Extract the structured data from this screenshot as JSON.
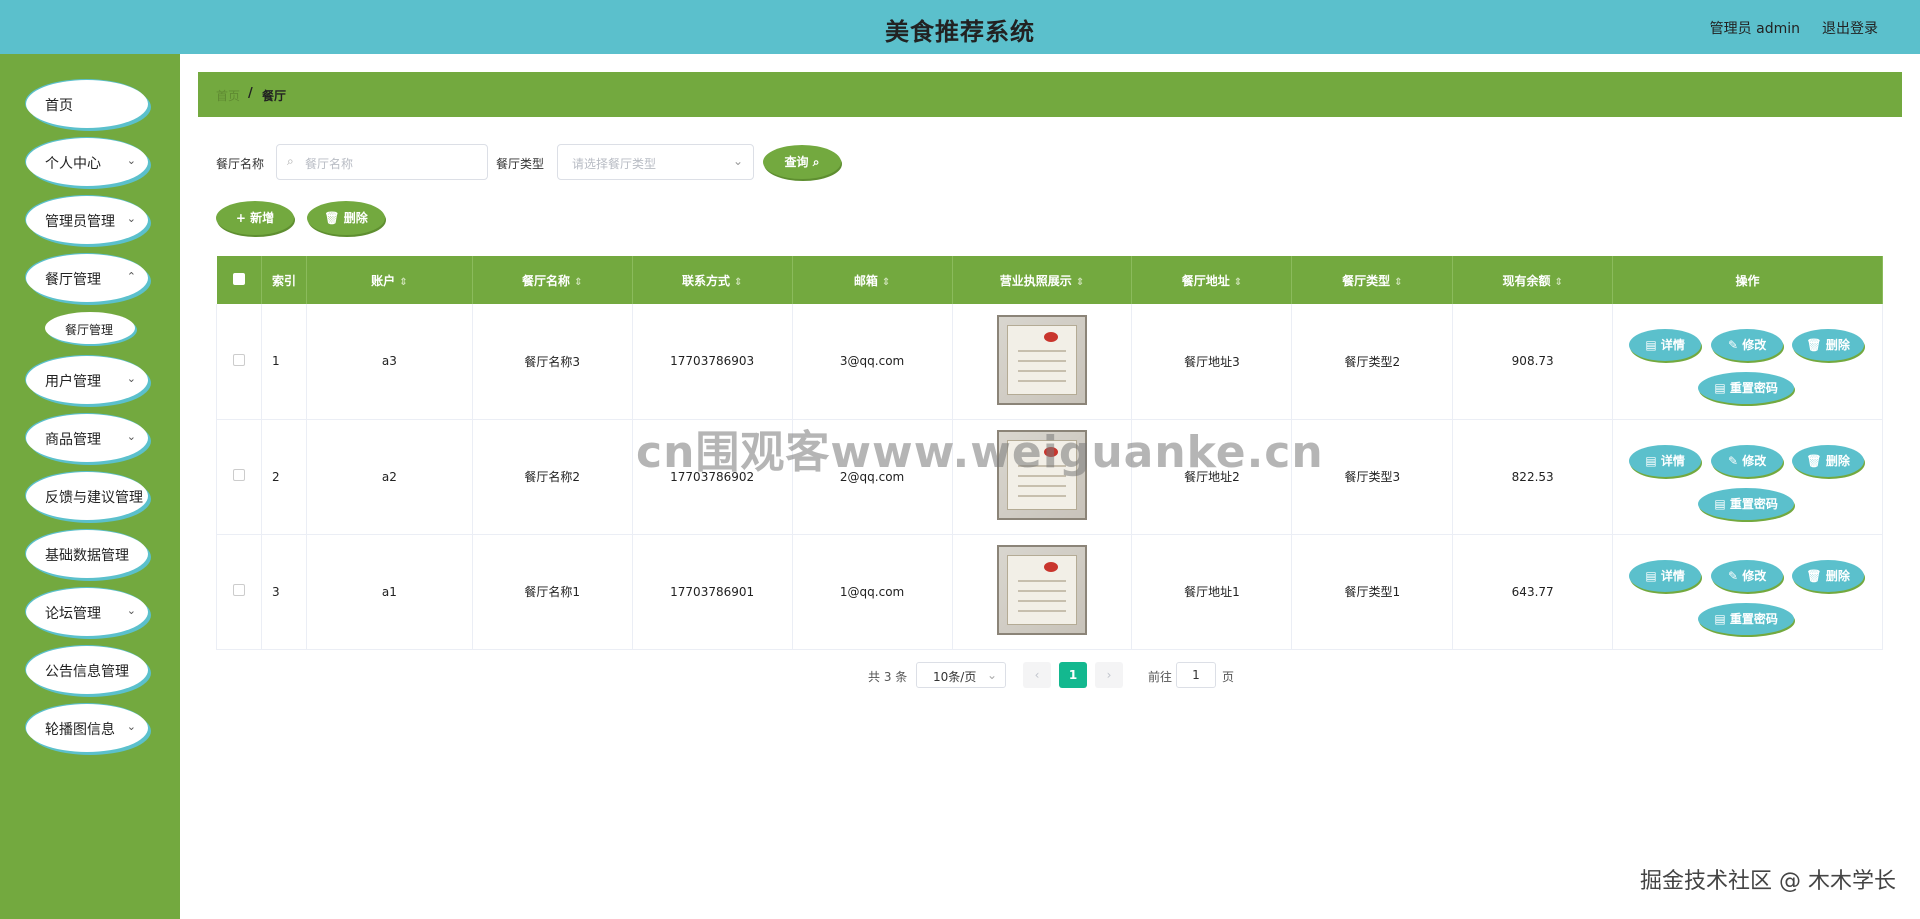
{
  "header": {
    "title": "美食推荐系统",
    "admin": "管理员 admin",
    "logout": "退出登录"
  },
  "sidebar": {
    "items": [
      {
        "label": "首页",
        "chevron": false
      },
      {
        "label": "个人中心",
        "chevron": true
      },
      {
        "label": "管理员管理",
        "chevron": true
      },
      {
        "label": "餐厅管理",
        "chevron": true
      },
      {
        "label": "用户管理",
        "chevron": true
      },
      {
        "label": "商品管理",
        "chevron": true
      },
      {
        "label": "反馈与建议管理",
        "chevron": true
      },
      {
        "label": "基础数据管理",
        "chevron": true
      },
      {
        "label": "论坛管理",
        "chevron": true
      },
      {
        "label": "公告信息管理",
        "chevron": true
      },
      {
        "label": "轮播图信息",
        "chevron": true
      }
    ],
    "sub_item": "餐厅管理"
  },
  "breadcrumb": {
    "home": "首页",
    "separator": "/",
    "current": "餐厅"
  },
  "search": {
    "name_label": "餐厅名称",
    "name_placeholder": "餐厅名称",
    "type_label": "餐厅类型",
    "type_placeholder": "请选择餐厅类型",
    "query_button": "查询 ⌕"
  },
  "actions": {
    "add": "+ 新增",
    "delete": "🗑 删除"
  },
  "table": {
    "headers": [
      "索引",
      "账户",
      "餐厅名称",
      "联系方式",
      "邮箱",
      "营业执照展示",
      "餐厅地址",
      "餐厅类型",
      "现有余额",
      "操作"
    ],
    "rows": [
      {
        "index": "1",
        "account": "a3",
        "name": "餐厅名称3",
        "phone": "17703786903",
        "email": "3@qq.com",
        "address": "餐厅地址3",
        "type": "餐厅类型2",
        "balance": "908.73"
      },
      {
        "index": "2",
        "account": "a2",
        "name": "餐厅名称2",
        "phone": "17703786902",
        "email": "2@qq.com",
        "address": "餐厅地址2",
        "type": "餐厅类型3",
        "balance": "822.53"
      },
      {
        "index": "3",
        "account": "a1",
        "name": "餐厅名称1",
        "phone": "17703786901",
        "email": "1@qq.com",
        "address": "餐厅地址1",
        "type": "餐厅类型1",
        "balance": "643.77"
      }
    ],
    "op_labels": {
      "detail": "详情",
      "edit": "修改",
      "delete": "删除",
      "reset": "重置密码"
    }
  },
  "pagination": {
    "total": "共 3 条",
    "page_size": "10条/页",
    "current": "1",
    "goto_label": "前往",
    "goto_value": "1",
    "page_suffix": "页"
  },
  "watermark": "cn围观客www.weiguanke.cn",
  "corner_mark": "掘金技术社区 @ 木木学长",
  "colors": {
    "header": "#5bc0cc",
    "sidebar": "#73a93f",
    "accent": "#13b88f"
  }
}
